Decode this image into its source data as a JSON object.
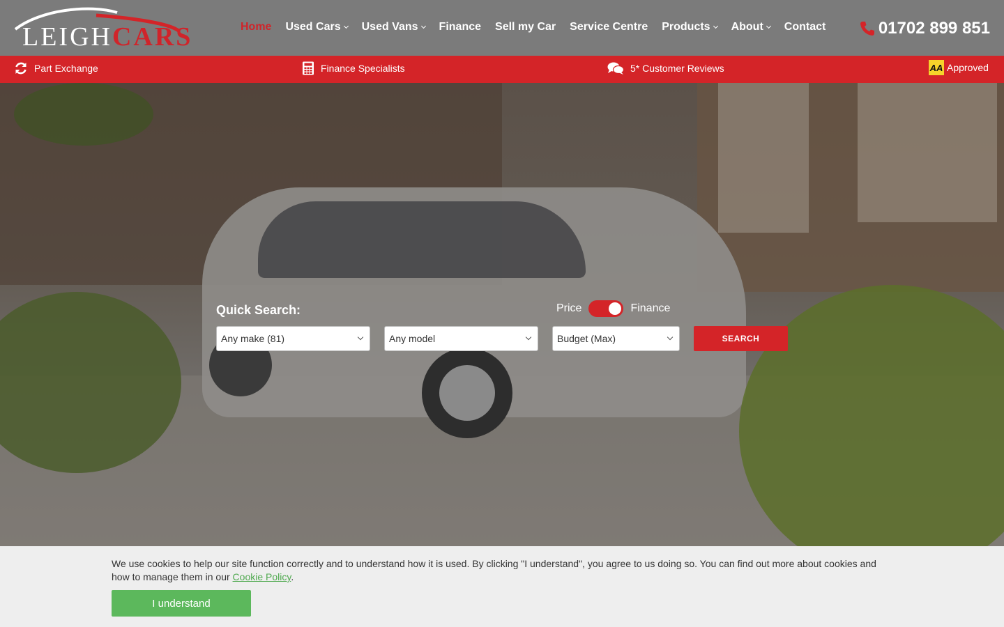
{
  "logo": {
    "part1": "LEIGH",
    "part2": "CARS"
  },
  "nav": {
    "home": "Home",
    "used_cars": "Used Cars",
    "used_vans": "Used Vans",
    "finance": "Finance",
    "sell": "Sell my Car",
    "service": "Service Centre",
    "products": "Products",
    "about": "About",
    "contact": "Contact"
  },
  "phone": "01702 899 851",
  "features": {
    "part_exchange": "Part Exchange",
    "finance": "Finance Specialists",
    "reviews": "5* Customer Reviews",
    "aa_badge": "AA",
    "aa_label": "Approved"
  },
  "search": {
    "label": "Quick Search:",
    "toggle_left": "Price",
    "toggle_right": "Finance",
    "make": "Any make (81)",
    "model": "Any model",
    "budget": "Budget (Max)",
    "button": "SEARCH"
  },
  "cookie": {
    "text": "We use cookies to help our site function correctly and to understand how it is used. By clicking \"I understand\", you agree to us doing so. You can find out more about cookies and how to manage them in our ",
    "link": "Cookie Policy",
    "end": ".",
    "button": "I understand"
  },
  "colors": {
    "brand_red": "#d42428",
    "header_grey": "#7b7b7b",
    "accept_green": "#5cb85c"
  },
  "icons": [
    "refresh-icon",
    "calculator-icon",
    "comments-icon",
    "phone-icon"
  ]
}
